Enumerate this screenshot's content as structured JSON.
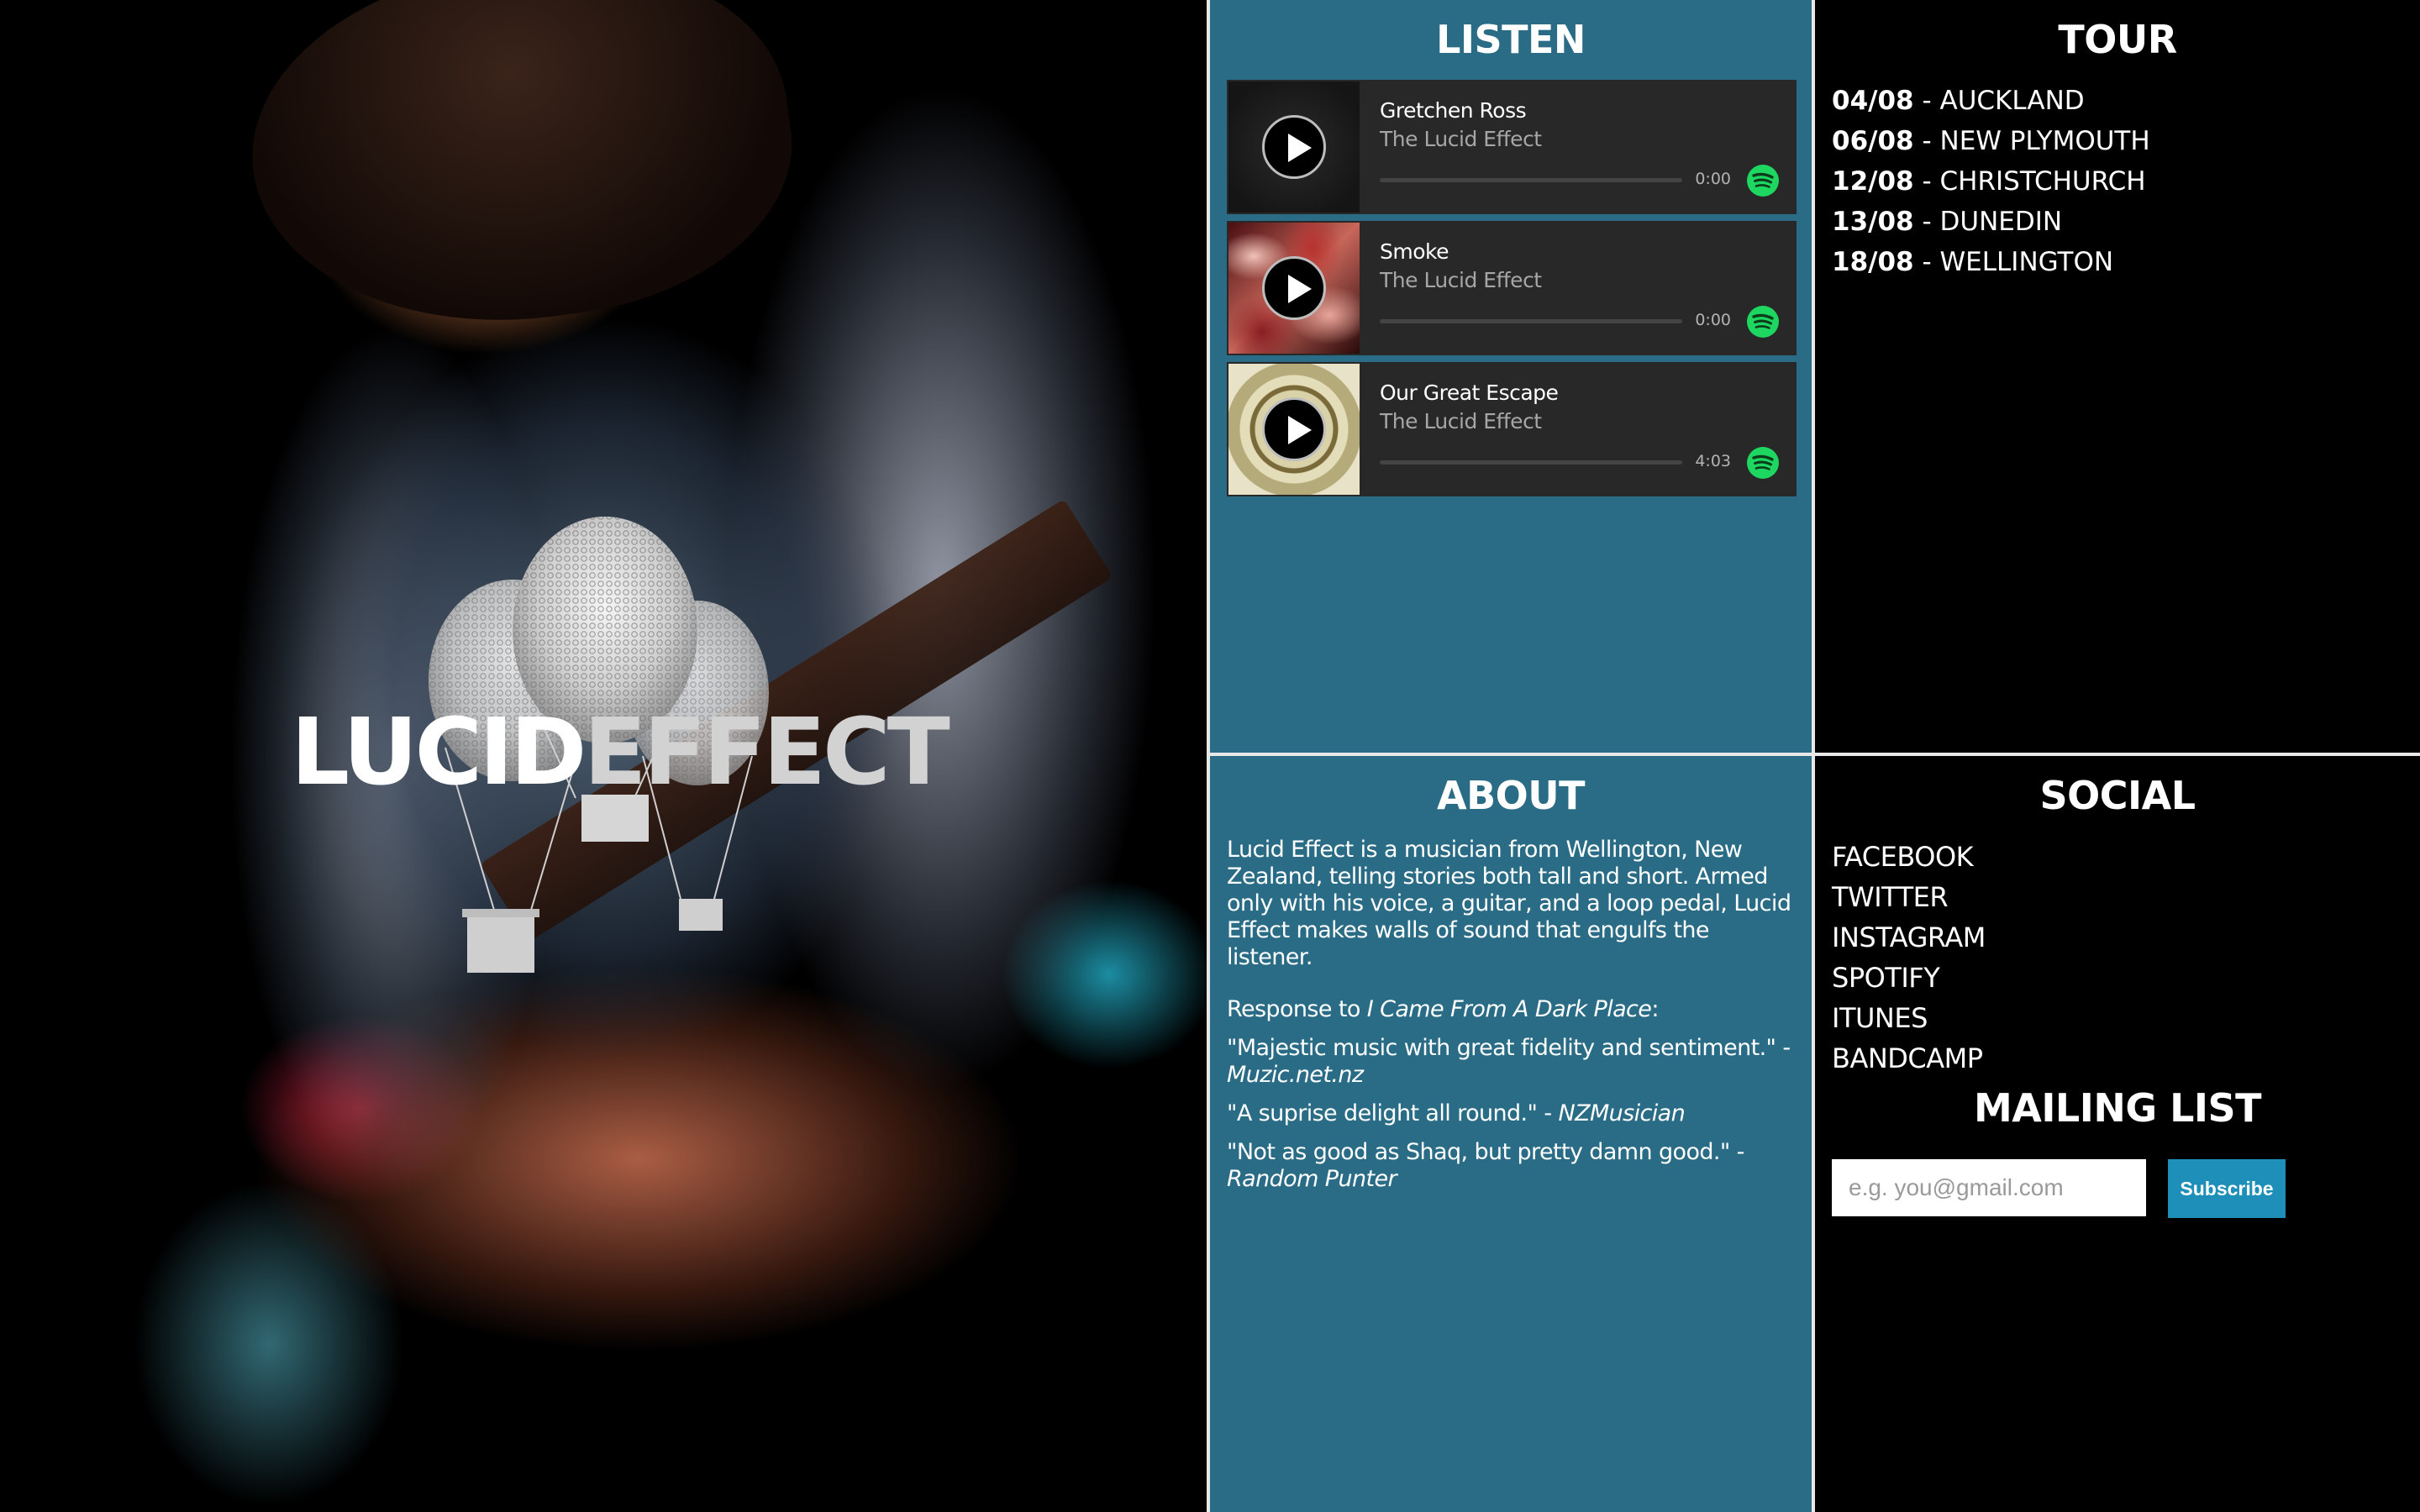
{
  "brand": {
    "logo_part1": "LUCID",
    "logo_part2": "EFFECT"
  },
  "listen": {
    "title": "LISTEN",
    "tracks": [
      {
        "name": "Gretchen Ross",
        "artist": "The Lucid Effect",
        "time": "0:00",
        "progress": 0.0
      },
      {
        "name": "Smoke",
        "artist": "The Lucid Effect",
        "time": "0:00",
        "progress": 0.0
      },
      {
        "name": "Our Great Escape",
        "artist": "The Lucid Effect",
        "time": "4:03",
        "progress": 0.0
      }
    ],
    "service_icon": "spotify-icon"
  },
  "tour": {
    "title": "TOUR",
    "dates": [
      {
        "date": "04/08",
        "sep": " - ",
        "city": "AUCKLAND"
      },
      {
        "date": "06/08",
        "sep": " - ",
        "city": "NEW PLYMOUTH"
      },
      {
        "date": "12/08",
        "sep": " - ",
        "city": "CHRISTCHURCH"
      },
      {
        "date": "13/08",
        "sep": " - ",
        "city": "DUNEDIN"
      },
      {
        "date": "18/08",
        "sep": " - ",
        "city": "WELLINGTON"
      }
    ]
  },
  "about": {
    "title": "ABOUT",
    "intro": "Lucid Effect is a musician from Wellington, New Zealand, telling stories both tall and short. Armed only with his voice, a guitar, and a loop pedal, Lucid Effect makes walls of sound that engulfs the listener.",
    "response_prefix": "Response to ",
    "response_album": "I Came From A Dark Place",
    "response_suffix": ":",
    "quotes": [
      {
        "text": "\"Majestic music with great fidelity and sentiment.\" - ",
        "source": "Muzic.net.nz"
      },
      {
        "text": "\"A suprise delight all round.\" - ",
        "source": "NZMusician"
      },
      {
        "text": "\"Not as good as Shaq, but pretty damn good.\" - ",
        "source": "Random Punter"
      }
    ]
  },
  "social": {
    "title": "SOCIAL",
    "links": [
      "FACEBOOK",
      "TWITTER",
      "INSTAGRAM",
      "SPOTIFY",
      "ITUNES",
      "BANDCAMP"
    ]
  },
  "mailing": {
    "title": "MAILING LIST",
    "placeholder": "e.g. you@gmail.com",
    "value": "",
    "button_label": "Subscribe"
  },
  "colors": {
    "panel_teal": "#2a6c85",
    "panel_black": "#000000",
    "player_bg": "#282828",
    "spotify_green": "#1ed760",
    "subscribe_blue": "#1e8fb8"
  }
}
